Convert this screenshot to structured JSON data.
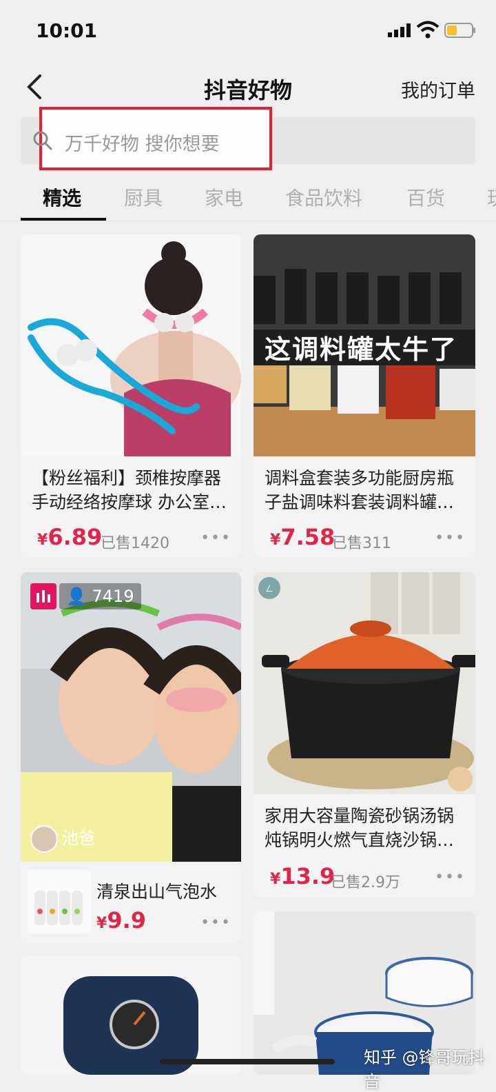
{
  "status": {
    "time": "10:01"
  },
  "nav": {
    "title": "抖音好物",
    "orders": "我的订单"
  },
  "search": {
    "placeholder": "万千好物 搜你想要"
  },
  "tabs": [
    "精选",
    "厨具",
    "家电",
    "食品饮料",
    "百货",
    "玩"
  ],
  "products": [
    {
      "title_line1": "【粉丝福利】颈椎按摩器",
      "title_line2": "手动经络按摩球 办公室…",
      "yen": "¥",
      "price": "6.89",
      "sold": "已售1420"
    },
    {
      "title_line1": "调料盒套装多功能厨房瓶",
      "title_line2": "子盐调味料套装调料罐…",
      "yen": "¥",
      "price": "7.58",
      "sold": "已售311",
      "image_caption": "这调料罐太牛了"
    },
    {
      "live_viewers": "7419",
      "streamer": "池爸",
      "title": "清泉出山气泡水",
      "yen": "¥",
      "price": "9.9"
    },
    {
      "title_line1": "家用大容量陶瓷砂锅汤锅",
      "title_line2": "炖锅明火燃气直烧沙锅…",
      "yen": "¥",
      "price": "13.9",
      "sold": "已售2.9万"
    }
  ],
  "more_glyph": "•••",
  "watermark": "知乎 @锋哥玩抖音",
  "colors": {
    "price": "#e0254a",
    "highlight": "#e6202e",
    "live_badge": "#e31560"
  }
}
